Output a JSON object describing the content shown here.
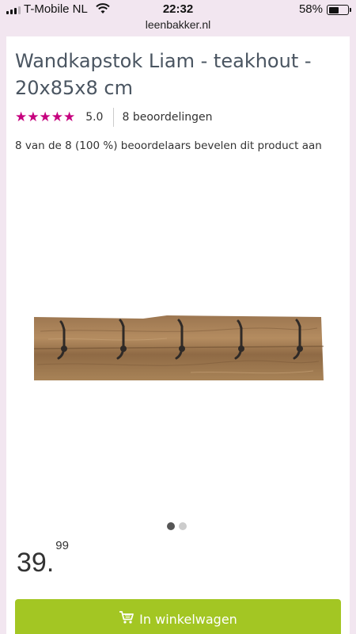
{
  "status_bar": {
    "carrier": "T-Mobile NL",
    "time": "22:32",
    "battery_percent": "58%",
    "battery_level": 0.58
  },
  "browser": {
    "url": "leenbakker.nl"
  },
  "product": {
    "title": "Wandkapstok Liam - teakhout - 20x85x8 cm",
    "stars": "★★★★★",
    "rating": "5.0",
    "review_count": "8 beoordelingen",
    "recommendation": "8 van de 8 (100 %) beoordelaars bevelen dit product aan",
    "price_main": "39.",
    "price_cents": "99",
    "add_to_cart_label": "In winkelwagen",
    "image_count": 2,
    "active_image": 1
  },
  "colors": {
    "star": "#c6007e",
    "button": "#a3c623",
    "title": "#4a5561",
    "header_bg": "#f2e6f0"
  },
  "icons": {
    "cart": "shopping-cart-icon",
    "wifi": "wifi-icon",
    "battery": "battery-icon",
    "signal": "cellular-signal-icon"
  }
}
